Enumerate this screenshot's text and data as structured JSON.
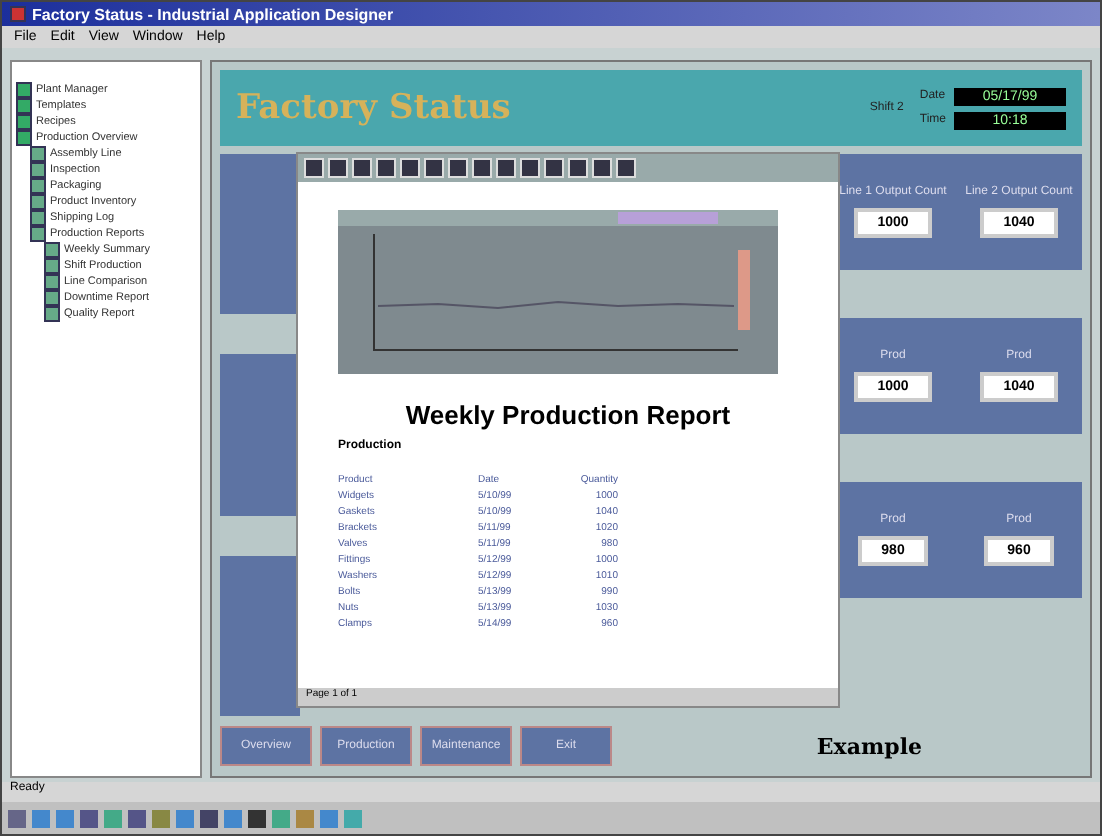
{
  "window": {
    "title": "Factory Status - Industrial Application Designer"
  },
  "menu": [
    "File",
    "Edit",
    "View",
    "Window",
    "Help"
  ],
  "tree": [
    {
      "label": "Plant Manager"
    },
    {
      "label": "Templates"
    },
    {
      "label": "Recipes"
    },
    {
      "label": "Production Overview",
      "children": [
        {
          "label": "Assembly Line"
        },
        {
          "label": "Inspection"
        },
        {
          "label": "Packaging"
        },
        {
          "label": "Product Inventory"
        },
        {
          "label": "Shipping Log"
        },
        {
          "label": "Production Reports",
          "children": [
            {
              "label": "Weekly Summary"
            },
            {
              "label": "Shift Production"
            },
            {
              "label": "Line Comparison"
            },
            {
              "label": "Downtime Report"
            },
            {
              "label": "Quality Report"
            }
          ]
        }
      ]
    }
  ],
  "header": {
    "title": "Factory Status",
    "note": "Shift 2",
    "date_label": "Date",
    "date": "05/17/99",
    "time_label": "Time",
    "time": "10:18"
  },
  "panels": [
    {
      "items": [
        {
          "label": "Line 1 Output Count",
          "value": "1000"
        },
        {
          "label": "Line 2 Output Count",
          "value": "1040"
        }
      ]
    },
    {
      "items": [
        {
          "label": "Prod",
          "value": "1000"
        },
        {
          "label": "Prod",
          "value": "1040"
        }
      ]
    },
    {
      "items": [
        {
          "label": "Prod",
          "value": "980"
        },
        {
          "label": "Prod",
          "value": "960"
        }
      ]
    }
  ],
  "report": {
    "title": "Weekly Production Report",
    "subtitle": "Production",
    "columns": [
      "Product",
      "Date",
      "Quantity"
    ],
    "rows": [
      [
        "Widgets",
        "5/10/99",
        "1000"
      ],
      [
        "Gaskets",
        "5/10/99",
        "1040"
      ],
      [
        "Brackets",
        "5/11/99",
        "1020"
      ],
      [
        "Valves",
        "5/11/99",
        "980"
      ],
      [
        "Fittings",
        "5/12/99",
        "1000"
      ],
      [
        "Washers",
        "5/12/99",
        "1010"
      ],
      [
        "Bolts",
        "5/13/99",
        "990"
      ],
      [
        "Nuts",
        "5/13/99",
        "1030"
      ],
      [
        "Clamps",
        "5/14/99",
        "960"
      ]
    ],
    "status": "Page 1 of 1"
  },
  "buttons": [
    "Overview",
    "Production",
    "Maintenance",
    "Exit"
  ],
  "brand": "Example",
  "status_bar": "Ready"
}
